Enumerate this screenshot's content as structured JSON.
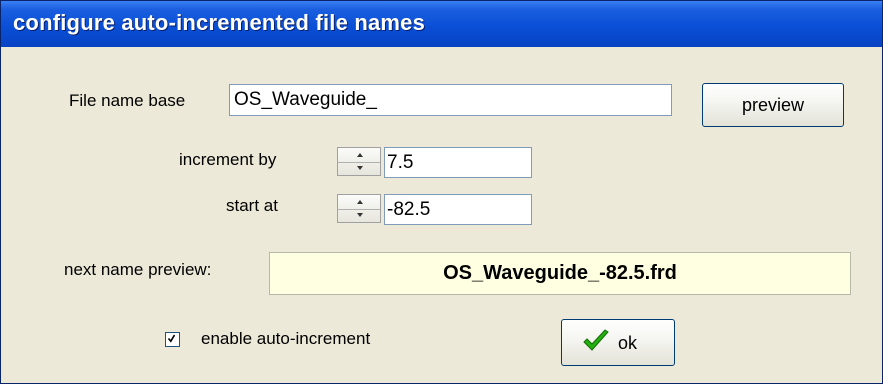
{
  "window": {
    "title": "configure auto-incremented file names"
  },
  "fields": {
    "file_name_base": {
      "label": "File name base",
      "value": "OS_Waveguide_"
    },
    "increment_by": {
      "label": "increment by",
      "value": "7.5"
    },
    "start_at": {
      "label": "start at",
      "value": "-82.5"
    },
    "next_name_preview": {
      "label": "next name preview:",
      "value": "OS_Waveguide_-82.5.frd"
    }
  },
  "buttons": {
    "preview": "preview",
    "ok": "ok"
  },
  "checkbox": {
    "label": "enable auto-increment",
    "checked": true
  },
  "icons": {
    "ok": "green-checkmark-icon",
    "check": "checkbox-check-icon",
    "spin": "spin-arrows-icon"
  },
  "colors": {
    "titlebar": "#0a4fd6",
    "dialog_bg": "#ece9d8",
    "preview_bg": "#ffffe1",
    "ok_check": "#22b00f"
  }
}
